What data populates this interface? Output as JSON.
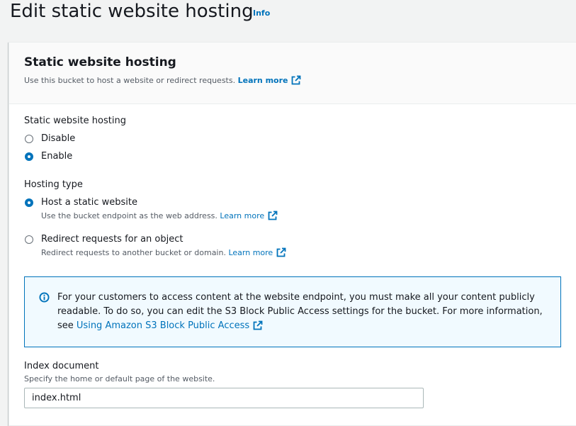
{
  "header": {
    "title": "Edit static website hosting",
    "info_label": "Info"
  },
  "panel": {
    "title": "Static website hosting",
    "description": "Use this bucket to host a website or redirect requests.",
    "learn_more": "Learn more"
  },
  "hosting_toggle": {
    "label": "Static website hosting",
    "options": [
      {
        "label": "Disable",
        "checked": false
      },
      {
        "label": "Enable",
        "checked": true
      }
    ]
  },
  "hosting_type": {
    "label": "Hosting type",
    "options": [
      {
        "label": "Host a static website",
        "description": "Use the bucket endpoint as the web address.",
        "learn_more": "Learn more",
        "checked": true
      },
      {
        "label": "Redirect requests for an object",
        "description": "Redirect requests to another bucket or domain.",
        "learn_more": "Learn more",
        "checked": false
      }
    ]
  },
  "alert": {
    "icon": "info-circle-icon",
    "text": "For your customers to access content at the website endpoint, you must make all your content publicly readable. To do so, you can edit the S3 Block Public Access settings for the bucket. For more information, see",
    "link": "Using Amazon S3 Block Public Access"
  },
  "index_document": {
    "label": "Index document",
    "description": "Specify the home or default page of the website.",
    "value": "index.html"
  },
  "colors": {
    "link": "#0073bb",
    "alert_bg": "#f1faff",
    "page_bg": "#f2f3f3"
  }
}
